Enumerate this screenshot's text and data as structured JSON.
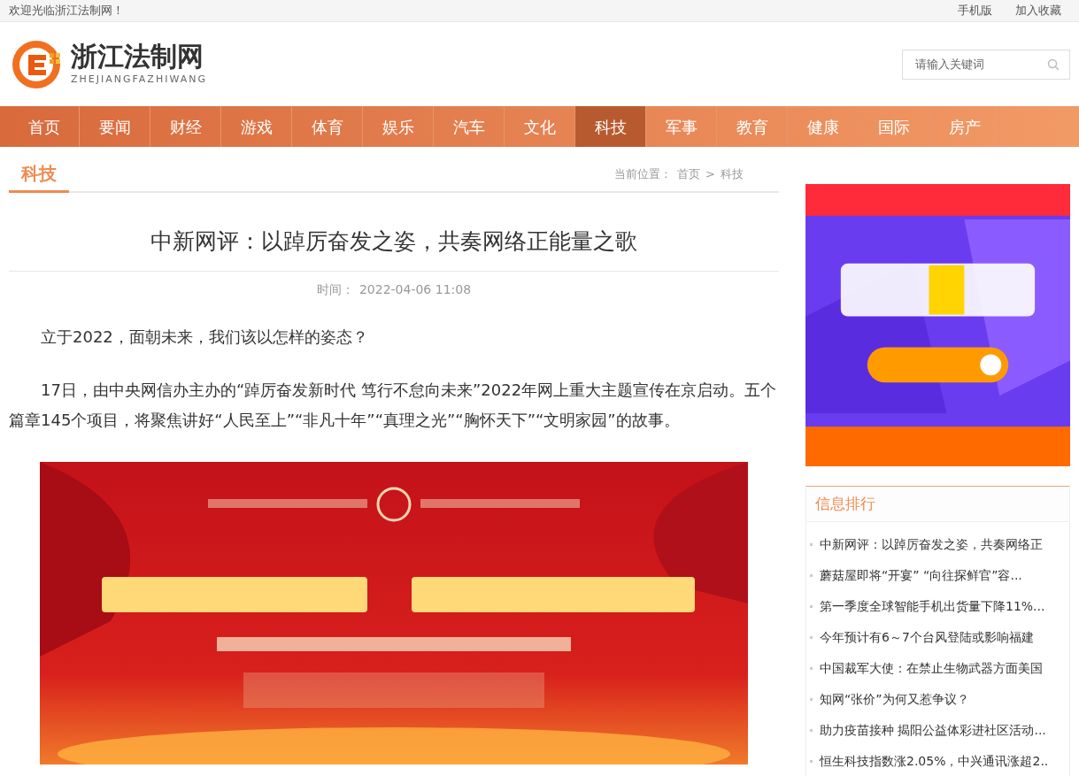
{
  "top_bar": {
    "welcome": "欢迎光临浙江法制网！",
    "links": [
      "手机版",
      "加入收藏"
    ]
  },
  "header": {
    "logo_title": "浙江法制网",
    "logo_subtitle": "ZHEJIANGFAZHIWANG",
    "search": {
      "placeholder": "请输入关键词"
    }
  },
  "nav": [
    {
      "label": "首页",
      "selected": false
    },
    {
      "label": "要闻",
      "selected": false
    },
    {
      "label": "财经",
      "selected": false
    },
    {
      "label": "游戏",
      "selected": false
    },
    {
      "label": "体育",
      "selected": false
    },
    {
      "label": "娱乐",
      "selected": false
    },
    {
      "label": "汽车",
      "selected": false
    },
    {
      "label": "文化",
      "selected": false
    },
    {
      "label": "科技",
      "selected": true
    },
    {
      "label": "军事",
      "selected": false
    },
    {
      "label": "教育",
      "selected": false
    },
    {
      "label": "健康",
      "selected": false
    },
    {
      "label": "国际",
      "selected": false
    },
    {
      "label": "房产",
      "selected": false
    }
  ],
  "section": {
    "title": "科技",
    "breadcrumb": {
      "prefix": "当前位置：",
      "items": [
        "首页",
        "科技"
      ],
      "separator": ">"
    }
  },
  "article": {
    "title": "中新网评：以踔厉奋发之姿，共奏网络正能量之歌",
    "time_label": "时间：",
    "time": "2022-04-06 11:08",
    "paragraphs": [
      "立于2022，面朝未来，我们该以怎样的姿态？",
      "17日，由中央网信办主办的“踔厉奋发新时代 笃行不怠向未来”2022年网上重大主题宣传在京启动。五个篇章145个项目，将聚焦讲好“人民至上”“非凡十年”“真理之光”“胸怀天下”“文明家园”的故事。"
    ]
  },
  "sidebar": {
    "ranking": {
      "title": "信息排行",
      "items": [
        "中新网评：以踔厉奋发之姿，共奏网络正",
        "蘑菇屋即将“开宴” “向往探鲜官”容...",
        "第一季度全球智能手机出货量下降11%...",
        "今年预计有6～7个台风登陆或影响福建",
        "中国裁军大使：在禁止生物武器方面美国",
        "知网“张价”为何又惹争议？",
        "助力疫苗接种 揭阳公益体彩进社区活动...",
        "恒生科技指数涨2.05%，中兴通讯涨超2.."
      ]
    }
  }
}
